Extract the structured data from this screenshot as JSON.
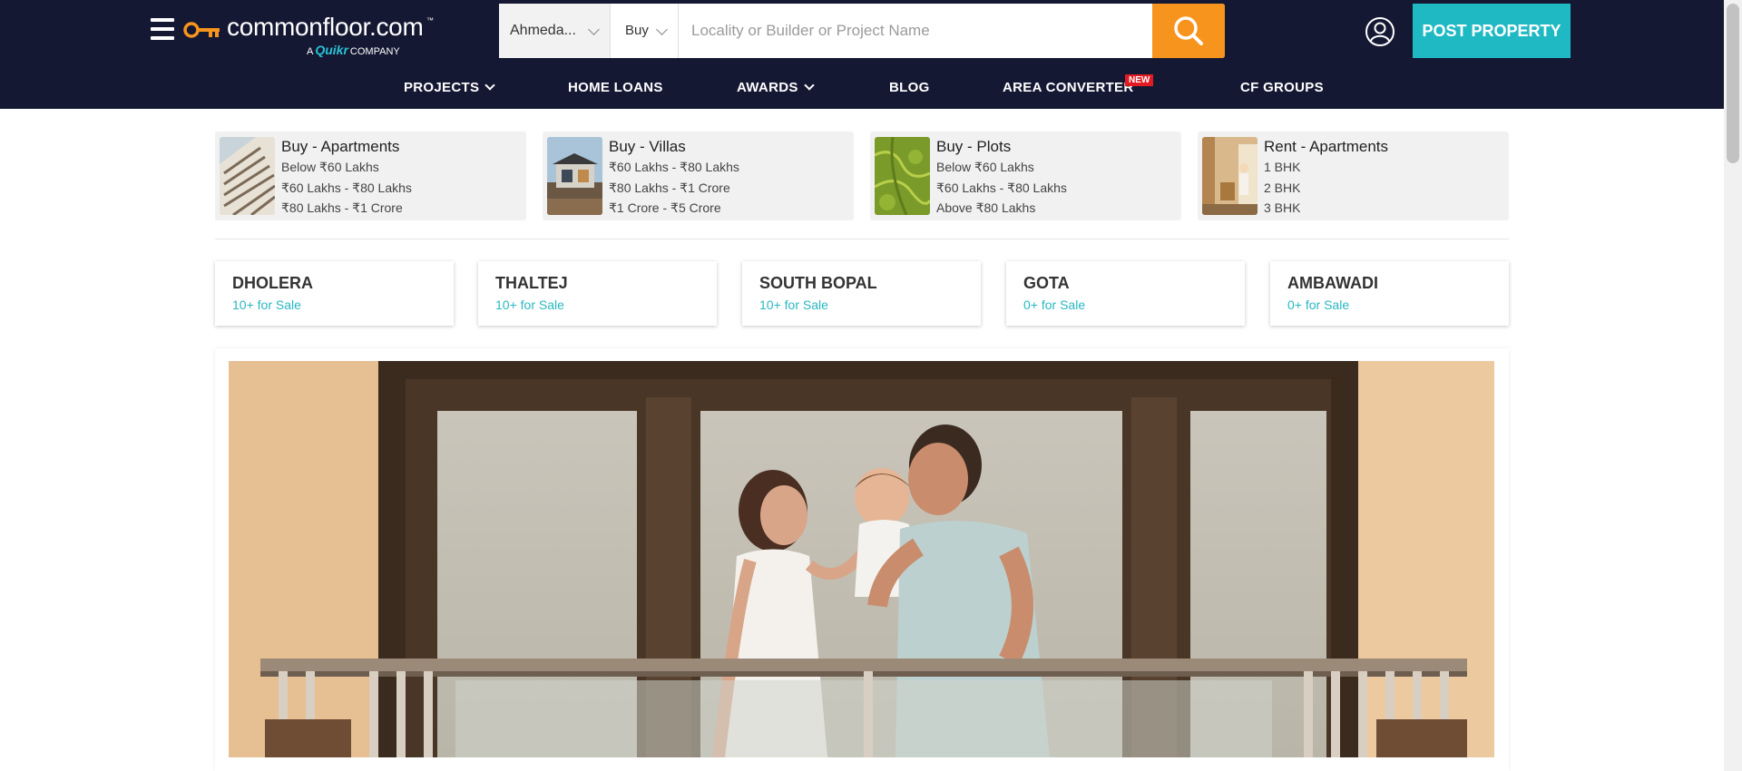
{
  "header": {
    "logo": {
      "name": "commonfloor.com",
      "tm": "™",
      "sub_prefix": "A",
      "sub_brand": "Quikr",
      "sub_suffix": "COMPANY"
    },
    "search": {
      "city": "Ahmeda...",
      "type": "Buy",
      "placeholder": "Locality or Builder or Project Name"
    },
    "post_property": "POST PROPERTY",
    "nav": [
      {
        "label": "PROJECTS",
        "dropdown": true
      },
      {
        "label": "HOME LOANS"
      },
      {
        "label": "AWARDS",
        "dropdown": true
      },
      {
        "label": "BLOG"
      },
      {
        "label": "AREA CONVERTER",
        "badge": "NEW"
      },
      {
        "label": "CF GROUPS"
      }
    ]
  },
  "categories": [
    {
      "title": "Buy - Apartments",
      "links": [
        "Below ₹60 Lakhs",
        "₹60 Lakhs - ₹80 Lakhs",
        "₹80 Lakhs - ₹1 Crore"
      ]
    },
    {
      "title": "Buy - Villas",
      "links": [
        "₹60 Lakhs - ₹80 Lakhs",
        "₹80 Lakhs - ₹1 Crore",
        "₹1 Crore - ₹5 Crore"
      ]
    },
    {
      "title": "Buy - Plots",
      "links": [
        "Below ₹60 Lakhs",
        "₹60 Lakhs - ₹80 Lakhs",
        "Above ₹80 Lakhs"
      ]
    },
    {
      "title": "Rent - Apartments",
      "links": [
        "1 BHK",
        "2 BHK",
        "3 BHK"
      ]
    }
  ],
  "localities": [
    {
      "name": "DHOLERA",
      "count": "10+ for Sale"
    },
    {
      "name": "THALTEJ",
      "count": "10+ for Sale"
    },
    {
      "name": "SOUTH BOPAL",
      "count": "10+ for Sale"
    },
    {
      "name": "GOTA",
      "count": "0+ for Sale"
    },
    {
      "name": "AMBAWADI",
      "count": "0+ for Sale"
    }
  ],
  "colors": {
    "header_bg": "#151833",
    "search_button": "#f7941d",
    "post_button": "#1fb9c4",
    "locality_count": "#2ab7c3",
    "new_badge": "#e21b22"
  },
  "icons": {
    "menu": "hamburger-menu-icon",
    "logo": "key-icon",
    "search": "search-icon",
    "user": "user-account-icon",
    "dropdown": "chevron-down-icon"
  }
}
